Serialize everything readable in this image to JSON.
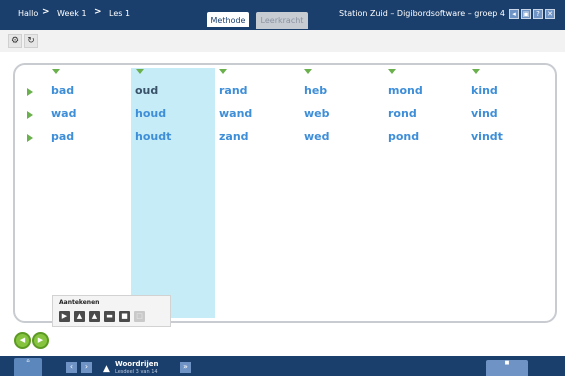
{
  "breadcrumb": {
    "hallo": "Hallo",
    "week": "Week 1",
    "les": "Les 1"
  },
  "tabs": {
    "methode": "Methode",
    "leerkracht": "Leerkracht"
  },
  "station_title": "Station Zuid – Digibordsoftware – groep 4",
  "window_buttons": [
    "◂",
    "▣",
    "?",
    "✕"
  ],
  "words": {
    "row1": [
      "bad",
      "oud",
      "rand",
      "heb",
      "mond",
      "kind"
    ],
    "row2": [
      "wad",
      "houd",
      "wand",
      "web",
      "rond",
      "vind"
    ],
    "row3": [
      "pad",
      "houdt",
      "zand",
      "wed",
      "pond",
      "vindt"
    ]
  },
  "annotation": {
    "title": "Aantekenen"
  },
  "footer": {
    "lesson_title": "Woordrijen",
    "lesson_sub": "Lesdeel 3 van 14"
  },
  "colors": {
    "nav_blue": "#1b3f6d",
    "highlight": "#c6ecf8",
    "word_blue": "#3e8ed8",
    "marker_green": "#6ab04c"
  }
}
